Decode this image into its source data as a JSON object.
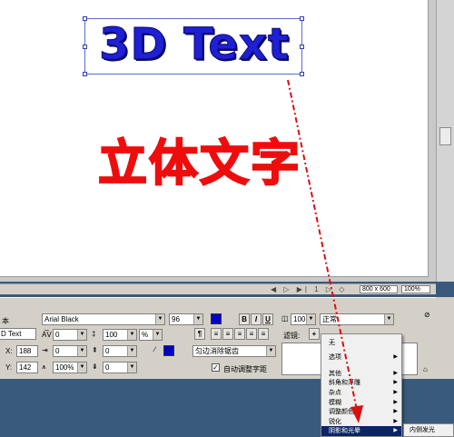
{
  "canvas": {
    "text_3d": "3D Text",
    "caption": "立体文字"
  },
  "status": {
    "nav_controls": "◀ ▷ ▶|  1   ▷ ◇",
    "size": "800 x 600",
    "zoom": "100%"
  },
  "props": {
    "panel_label": "本",
    "text_value": "D Text",
    "font": "Arial Black",
    "font_size": "96",
    "bold": "B",
    "italic": "I",
    "underline": "U",
    "opacity": "100",
    "blend_mode": "正常",
    "tracking": "0",
    "leading": "100",
    "leading_unit": "%",
    "x_label": "X:",
    "x_value": "188",
    "y_label": "Y:",
    "y_value": "142",
    "indent": "0",
    "space_before": "0",
    "space_after": "0",
    "space_after2": "0",
    "scale": "100%",
    "antialias": "匀边消除锯齿",
    "auto_kern": "自动调整字距",
    "filter_label": "滤镜:",
    "text_color": "#0000c8"
  },
  "menu": {
    "items": [
      {
        "label": "无"
      },
      {
        "label": "选项"
      },
      {
        "label": "其他"
      },
      {
        "label": "斜角和浮雕"
      },
      {
        "label": "杂点"
      },
      {
        "label": "模糊"
      },
      {
        "label": "调整颜色"
      },
      {
        "label": "锐化"
      },
      {
        "label": "阴影和光晕"
      }
    ],
    "submenu_item": "内侧发光"
  }
}
